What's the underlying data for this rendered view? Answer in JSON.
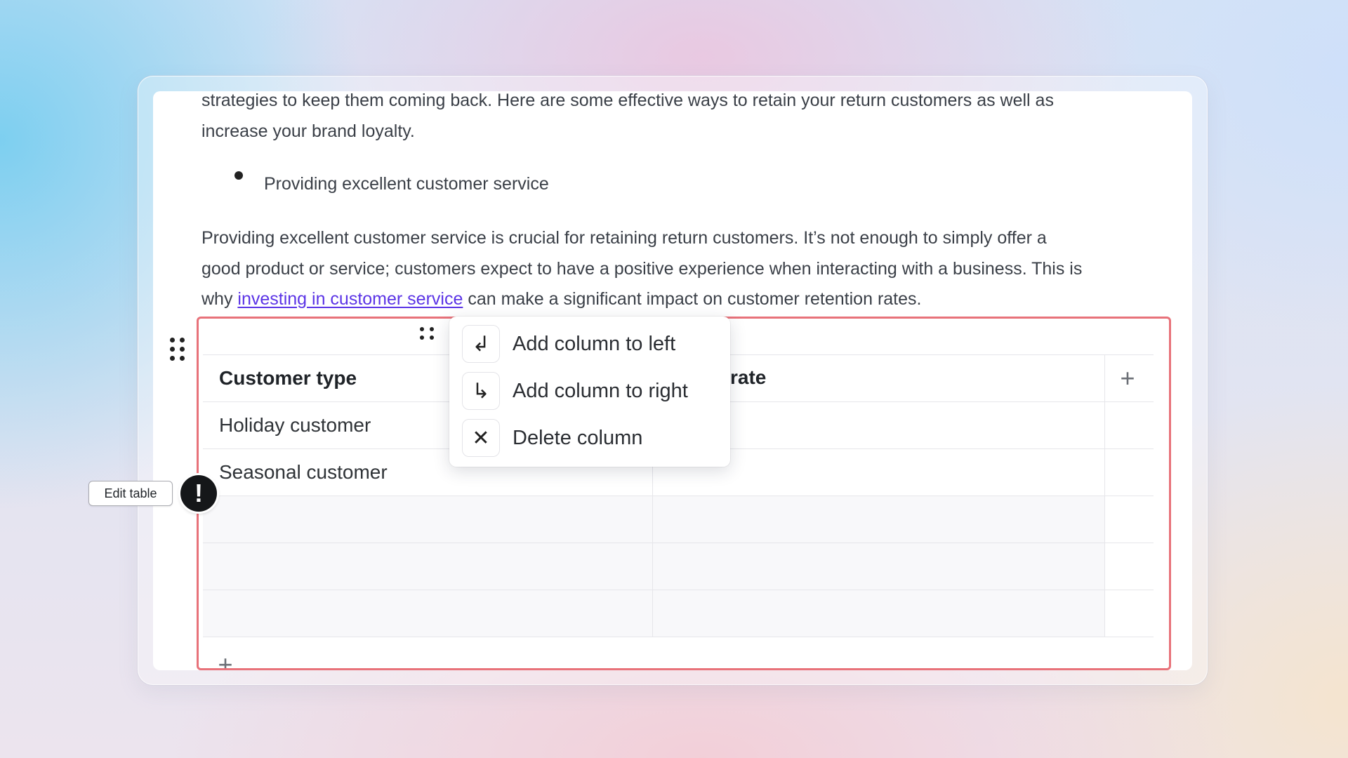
{
  "document": {
    "para1_line1": "strategies to keep them coming back. Here are some effective ways to retain your return customers as well as",
    "para1_line2": "increase your brand loyalty.",
    "bullet": "Providing excellent customer service",
    "para2_line1": "Providing excellent customer service is crucial for retaining return customers. It’s not enough to simply offer a",
    "para2_line2": "good product or service; customers expect to have a positive experience when interacting with a business. This is",
    "para2_prefix": "why ",
    "para2_link": "investing in customer service",
    "para2_suffix": " can make a significant impact on customer retention rates."
  },
  "table": {
    "header": [
      "Customer type",
      "rate"
    ],
    "rows": [
      [
        "Holiday customer",
        ""
      ],
      [
        "Seasonal customer",
        ""
      ],
      [
        "",
        ""
      ],
      [
        "",
        ""
      ],
      [
        "",
        ""
      ]
    ],
    "add_column_symbol": "+",
    "add_row_symbol": "+"
  },
  "context_menu": {
    "items": [
      {
        "label": "Add column to left",
        "icon": "arrow-turn-down-left-icon",
        "glyph": "↲"
      },
      {
        "label": "Add column to right",
        "icon": "arrow-turn-down-right-icon",
        "glyph": "↳"
      },
      {
        "label": "Delete column",
        "icon": "close-icon",
        "glyph": "✕"
      }
    ]
  },
  "edit_table": {
    "label": "Edit table",
    "alert_glyph": "!"
  },
  "colors": {
    "table_border": "#e8727a",
    "link": "#5b34e6",
    "alert_bg": "#151719"
  }
}
